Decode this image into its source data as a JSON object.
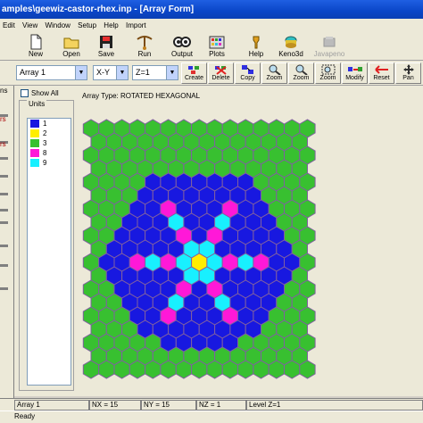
{
  "window": {
    "title": "amples\\geewiz-castor-rhex.inp - [Array Form]"
  },
  "menu": [
    "Edit",
    "View",
    "Window",
    "Setup",
    "Help",
    "Import"
  ],
  "toolbar": [
    {
      "label": "New",
      "icon": "new-file-icon"
    },
    {
      "label": "Open",
      "icon": "open-folder-icon"
    },
    {
      "label": "Save",
      "icon": "save-disk-icon"
    },
    {
      "label": "Run",
      "icon": "run-icon"
    },
    {
      "label": "Output",
      "icon": "output-icon"
    },
    {
      "label": "Plots",
      "icon": "plots-icon"
    },
    {
      "label": "Help",
      "icon": "help-icon"
    },
    {
      "label": "Keno3d",
      "icon": "keno3d-icon"
    },
    {
      "label": "Javapeno",
      "icon": "javapeno-icon",
      "disabled": true
    }
  ],
  "array_toolbar": {
    "array_select": "Array 1",
    "plane_select": "X-Y",
    "z_select": "Z=1",
    "buttons": [
      "Create",
      "Delete",
      "Copy",
      "Zoom",
      "Zoom",
      "Zoom",
      "Modify",
      "Reset",
      "Pan"
    ]
  },
  "left_panel_text": [
    "ns",
    "rs",
    "rs"
  ],
  "side": {
    "show_all": "Show All",
    "units_label": "Units",
    "units": [
      {
        "id": "1",
        "color": "#1818e0"
      },
      {
        "id": "2",
        "color": "#ffee00"
      },
      {
        "id": "3",
        "color": "#38c030"
      },
      {
        "id": "8",
        "color": "#ff18d8"
      },
      {
        "id": "9",
        "color": "#18f0ff"
      }
    ]
  },
  "array_type": "Array Type: ROTATED HEXAGONAL",
  "status": {
    "array": "Array  1",
    "nx": "NX = 15",
    "ny": "NY =  15",
    "nz": "NZ = 1",
    "level": "Level Z=1",
    "ready": "Ready"
  }
}
